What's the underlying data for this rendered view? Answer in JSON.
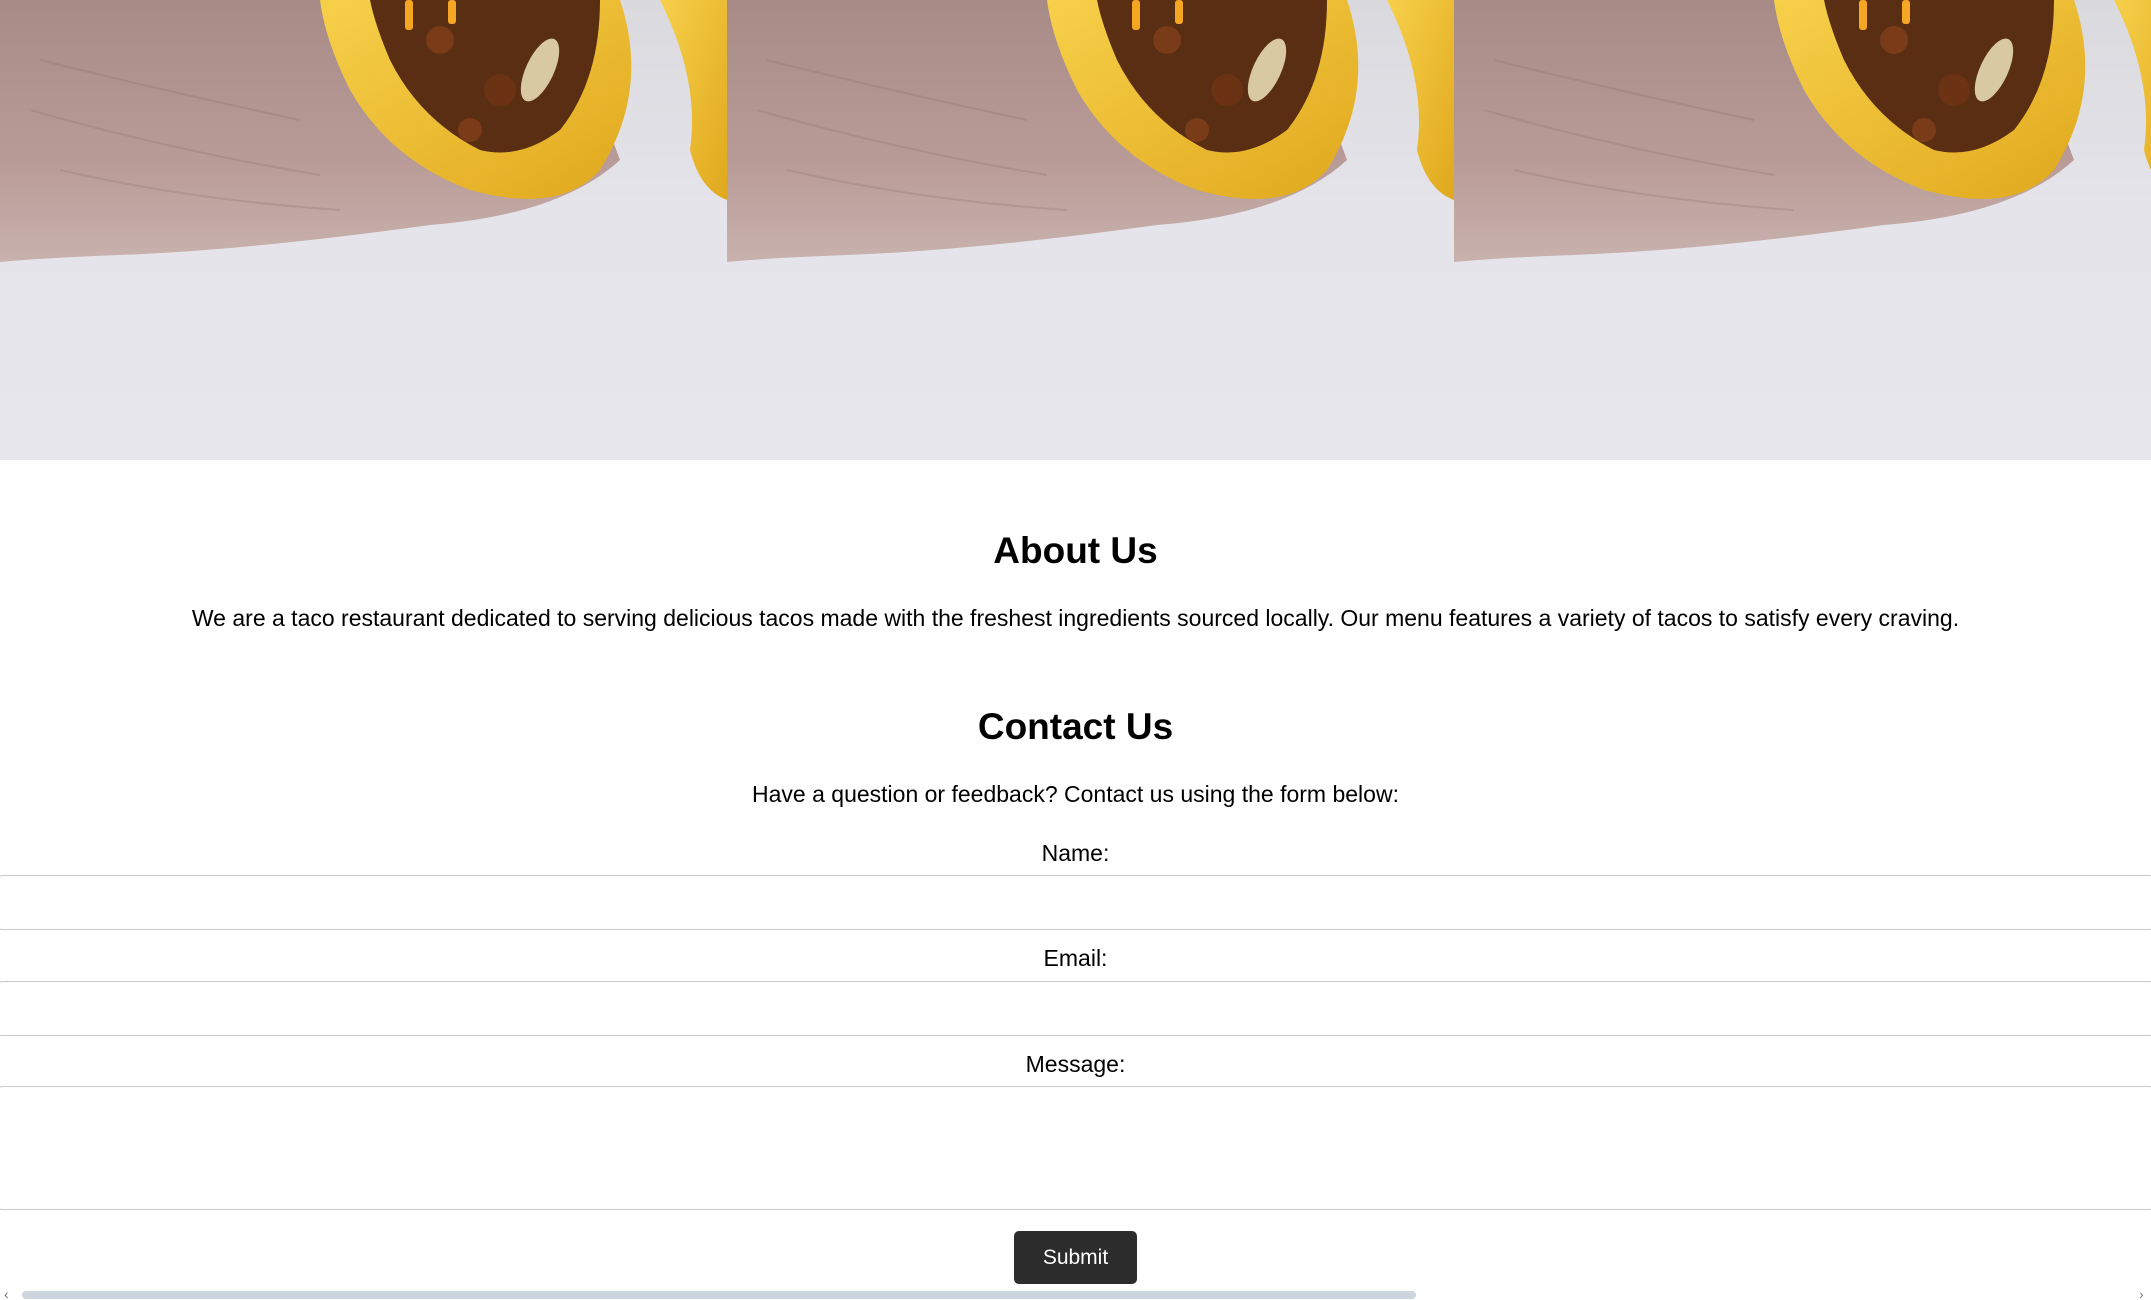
{
  "hero": {
    "tiles": [
      "taco-photo",
      "taco-photo",
      "taco-photo"
    ]
  },
  "about": {
    "title": "About Us",
    "text": "We are a taco restaurant dedicated to serving delicious tacos made with the freshest ingredients sourced locally. Our menu features a variety of tacos to satisfy every craving."
  },
  "contact": {
    "title": "Contact Us",
    "intro": "Have a question or feedback? Contact us using the form below:",
    "form": {
      "name_label": "Name:",
      "name_value": "",
      "email_label": "Email:",
      "email_value": "",
      "message_label": "Message:",
      "message_value": "",
      "submit_label": "Submit"
    }
  },
  "scrollbar": {
    "left_arrow_icon": "chevron-left-icon",
    "right_arrow_icon": "chevron-right-icon",
    "left_glyph": "‹",
    "right_glyph": "›"
  },
  "colors": {
    "button_bg": "#2c2c2c",
    "taco_shell": "#f2c12e",
    "meat": "#5a2e12",
    "skin": "#b89a96",
    "backdrop": "#e4e4ea"
  }
}
